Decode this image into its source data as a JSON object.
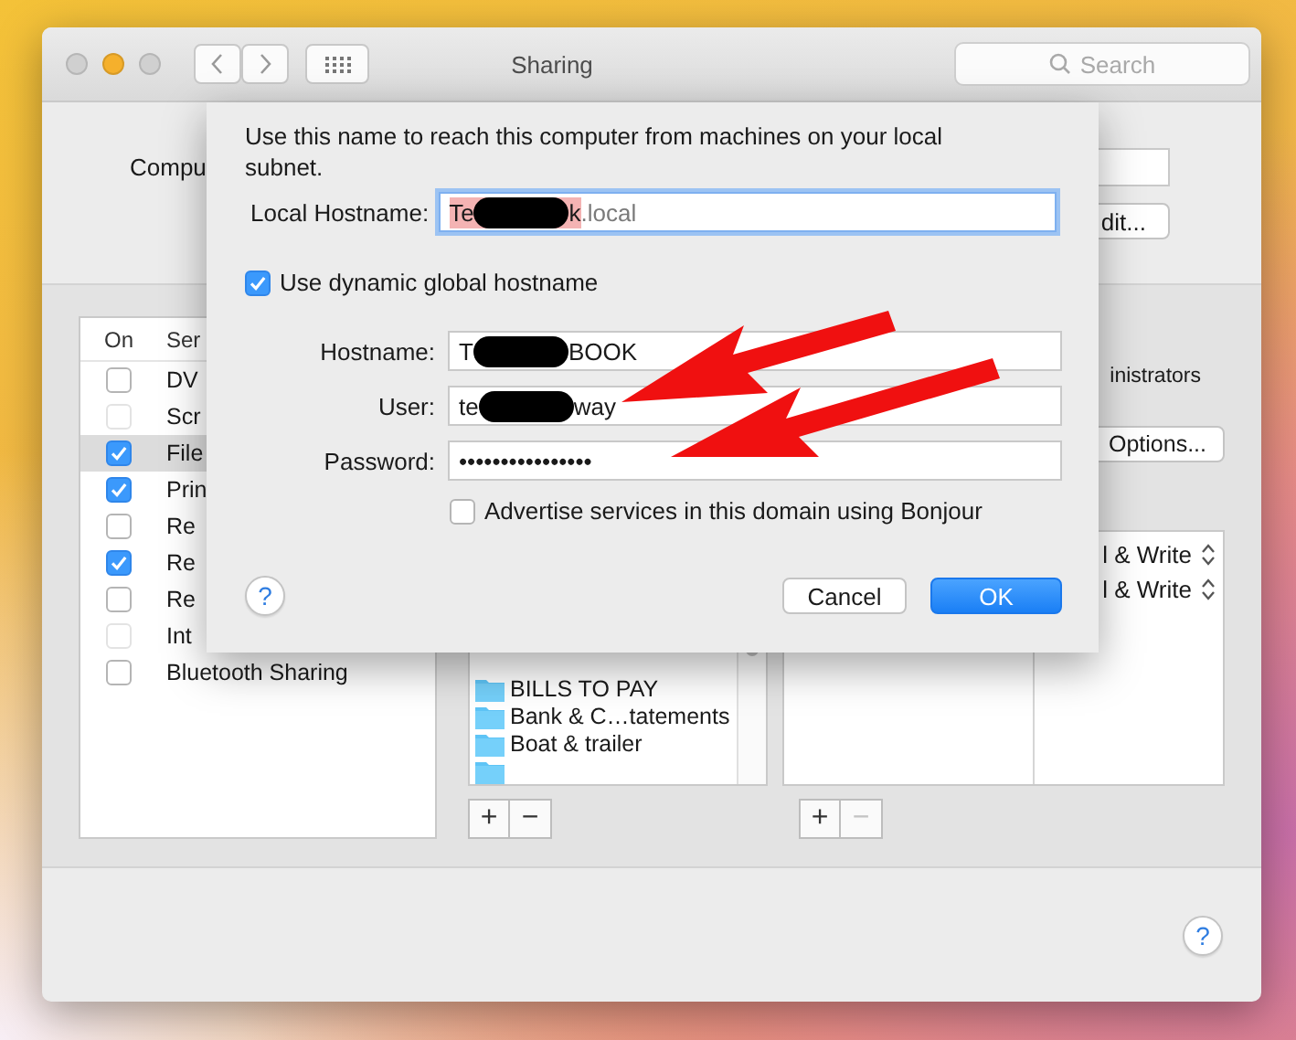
{
  "window": {
    "title": "Sharing",
    "search_placeholder": "Search"
  },
  "computer_name": {
    "label": "Compu",
    "edit_button": "dit..."
  },
  "services": {
    "columns": [
      "On",
      "Ser"
    ],
    "rows": [
      {
        "name": "DV",
        "checked": false,
        "disabled": false,
        "selected": false
      },
      {
        "name": "Scr",
        "checked": false,
        "disabled": true,
        "selected": false
      },
      {
        "name": "File",
        "checked": true,
        "disabled": false,
        "selected": true
      },
      {
        "name": "Prin",
        "checked": true,
        "disabled": false,
        "selected": false
      },
      {
        "name": "Re",
        "checked": false,
        "disabled": false,
        "selected": false
      },
      {
        "name": "Re",
        "checked": true,
        "disabled": false,
        "selected": false
      },
      {
        "name": "Re",
        "checked": false,
        "disabled": false,
        "selected": false
      },
      {
        "name": "Int",
        "checked": false,
        "disabled": true,
        "selected": false
      },
      {
        "name": "Bluetooth Sharing",
        "checked": false,
        "disabled": false,
        "selected": false
      }
    ]
  },
  "access_text": "inistrators",
  "options_button": "Options...",
  "shared_folders": [
    "BILLS TO PAY",
    "Bank & C…tatements",
    "Boat & trailer"
  ],
  "folder_buttons": [
    {
      "label": "+",
      "disabled": false
    },
    {
      "label": "−",
      "disabled": false
    }
  ],
  "permissions": [
    "l & Write",
    "l & Write"
  ],
  "user_buttons": [
    {
      "label": "+",
      "disabled": false
    },
    {
      "label": "−",
      "disabled": true
    }
  ],
  "help_button": "?",
  "sheet": {
    "description": "Use this name to reach this computer from machines on your local subnet.",
    "local_hostname": {
      "label": "Local Hostname:",
      "value_start": "Te",
      "value_end": "k",
      "suffix": ".local",
      "redacted": true,
      "focused": true
    },
    "dynamic_hostname": {
      "label": "Use dynamic global hostname",
      "checked": true
    },
    "fields": [
      {
        "label": "Hostname:",
        "value_start": "T",
        "value_end": "BOOK",
        "redacted": true
      },
      {
        "label": "User:",
        "value_start": "te",
        "value_end": "way",
        "redacted": true
      },
      {
        "label": "Password:",
        "value_start": "••••••••••••••••",
        "redacted": false
      }
    ],
    "bonjour": {
      "label": "Advertise services in this domain using Bonjour",
      "checked": false
    },
    "help_button": "?",
    "buttons": [
      {
        "label": "Cancel",
        "default": false
      },
      {
        "label": "OK",
        "default": true
      }
    ]
  },
  "annotations": [
    {
      "kind": "arrow"
    },
    {
      "kind": "arrow"
    }
  ]
}
